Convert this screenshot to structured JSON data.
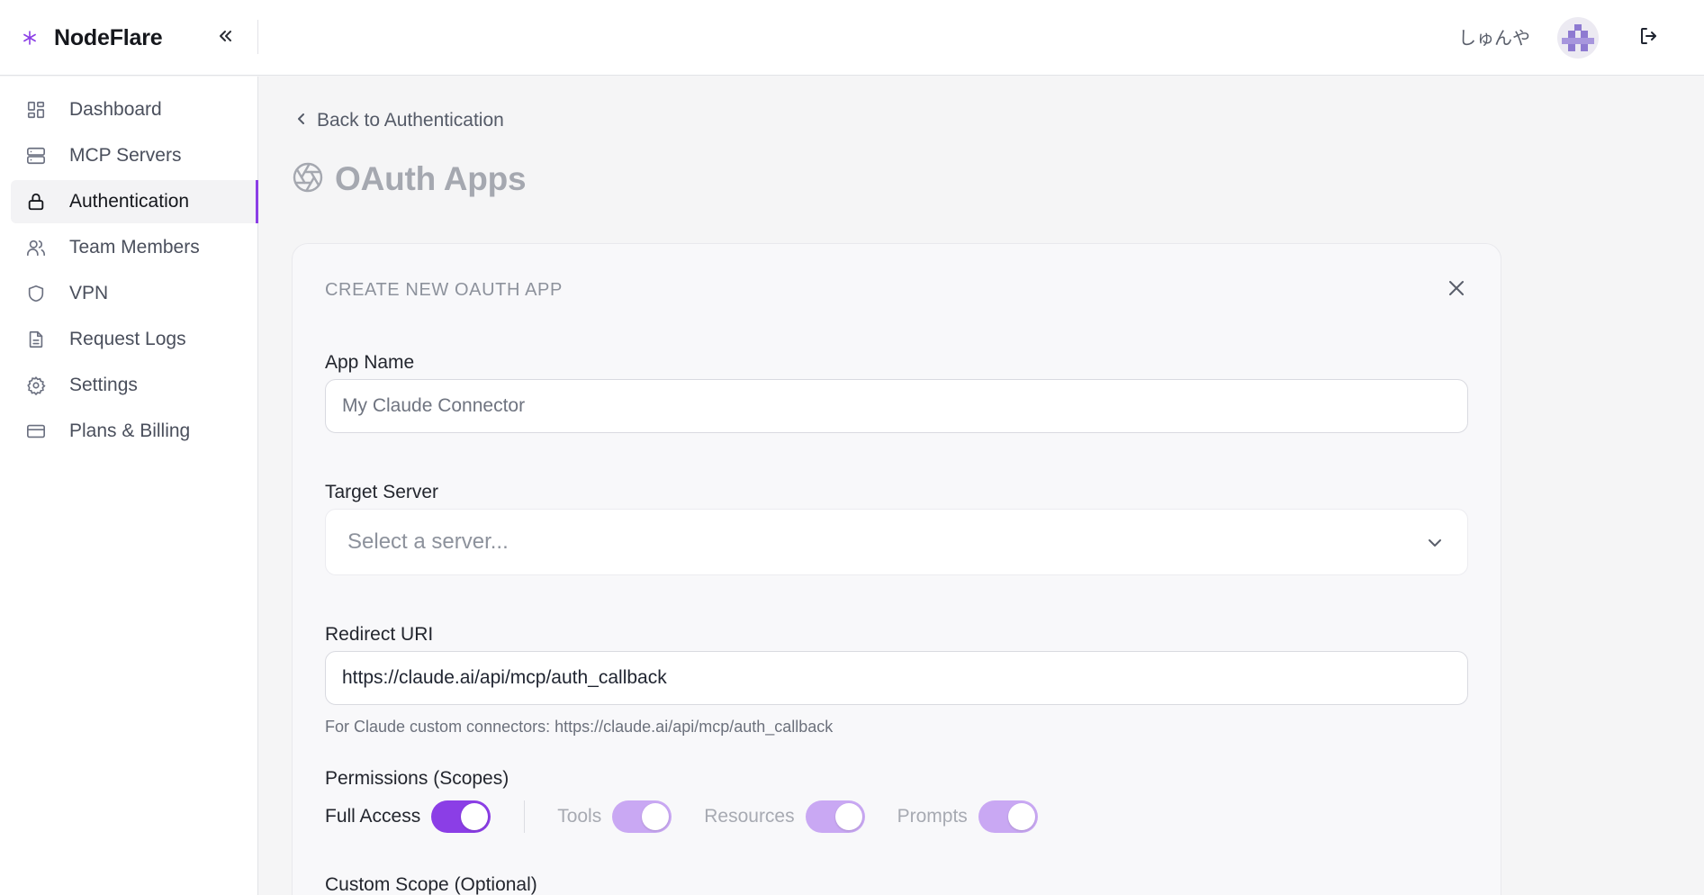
{
  "header": {
    "brand_name": "NodeFlare",
    "user_name": "しゅんや",
    "colors": {
      "accent": "#8b3ee6",
      "accent_light": "#c9a8f3"
    }
  },
  "sidebar": {
    "items": [
      {
        "label": "Dashboard",
        "icon": "dashboard-icon"
      },
      {
        "label": "MCP Servers",
        "icon": "server-icon"
      },
      {
        "label": "Authentication",
        "icon": "lock-icon",
        "active": true
      },
      {
        "label": "Team Members",
        "icon": "users-icon"
      },
      {
        "label": "VPN",
        "icon": "shield-icon"
      },
      {
        "label": "Request Logs",
        "icon": "file-text-icon"
      },
      {
        "label": "Settings",
        "icon": "gear-icon"
      },
      {
        "label": "Plans & Billing",
        "icon": "credit-card-icon"
      }
    ]
  },
  "main": {
    "back_label": "Back to Authentication",
    "page_title": "OAuth Apps",
    "form": {
      "title": "CREATE NEW OAUTH APP",
      "app_name": {
        "label": "App Name",
        "value": "",
        "placeholder": "My Claude Connector"
      },
      "target_server": {
        "label": "Target Server",
        "selected": "Select a server..."
      },
      "redirect_uri": {
        "label": "Redirect URI",
        "value": "https://claude.ai/api/mcp/auth_callback",
        "help": "For Claude custom connectors: https://claude.ai/api/mcp/auth_callback"
      },
      "permissions": {
        "label": "Permissions (Scopes)",
        "scopes": [
          {
            "label": "Full Access",
            "enabled": true
          },
          {
            "label": "Tools",
            "enabled": true,
            "disabled": true
          },
          {
            "label": "Resources",
            "enabled": true,
            "disabled": true
          },
          {
            "label": "Prompts",
            "enabled": true,
            "disabled": true
          }
        ]
      },
      "custom_scope": {
        "label": "Custom Scope (Optional)"
      }
    }
  }
}
